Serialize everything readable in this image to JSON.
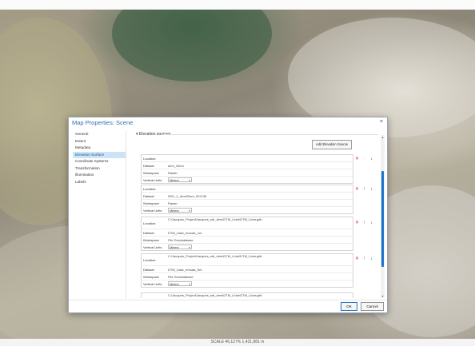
{
  "dialog": {
    "title": "Map Properties: Scene",
    "close_glyph": "×"
  },
  "nav": {
    "items": [
      {
        "label": "General",
        "selected": false
      },
      {
        "label": "Extent",
        "selected": false
      },
      {
        "label": "Metadata",
        "selected": false
      },
      {
        "label": "Elevation Surface",
        "selected": true
      },
      {
        "label": "Coordinate Systems",
        "selected": false
      },
      {
        "label": "Transformation",
        "selected": false
      },
      {
        "label": "Illumination",
        "selected": false
      },
      {
        "label": "Labels",
        "selected": false
      }
    ]
  },
  "elevation": {
    "section_title": "Elevation sources",
    "add_button": "Add Elevation Source",
    "labels": {
      "location": "Location:",
      "dataset": "Dataset",
      "workspace": "Workspace",
      "vertical_units": "Vertical Units"
    },
    "units_value": "Meters",
    "sources": [
      {
        "location": "",
        "dataset": "dem_25cm",
        "workspace": "Raster"
      },
      {
        "location": "",
        "dataset": "DSC_1_dem25cm_022136",
        "workspace": "Raster"
      },
      {
        "location": "C:\\Jacques_Project\\Jacques_std_dem\\DTM_Lidar\\DTM_Lidar.gdb",
        "dataset": "DTM_Lidar_mosaic_1m",
        "workspace": "File Geodatabase"
      },
      {
        "location": "C:\\Jacques_Project\\Jacques_std_dem\\DTM_Lidar\\DTM_Lidar.gdb",
        "dataset": "DTM_Lidar_mosaic_5m",
        "workspace": "File Geodatabase"
      },
      {
        "location": "C:\\Jacques_Project\\Jacques_std_dem\\DTM_Lidar\\DTM_Lidar.gdb",
        "dataset": "",
        "workspace": ""
      }
    ]
  },
  "footer": {
    "ok": "OK",
    "cancel": "Cancel"
  },
  "statusbar": {
    "text": "SCALE 46,127% 1,431,881 m"
  },
  "colors": {
    "accent": "#1a73c7",
    "remove": "#d13b2a",
    "title": "#2f6fb0"
  }
}
